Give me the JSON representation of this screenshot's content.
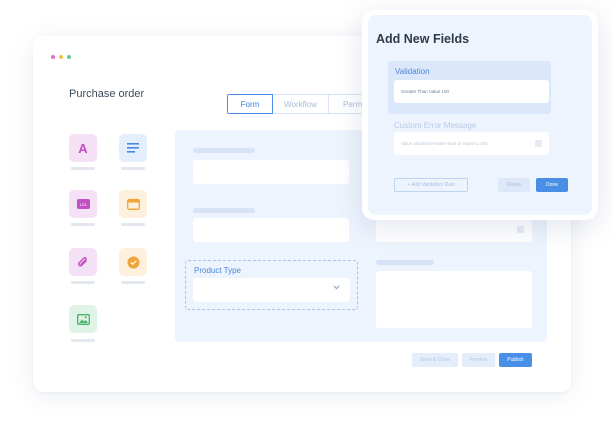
{
  "window": {
    "title": "Purchase order",
    "dots": [
      "#e66ad1",
      "#f2c04d",
      "#5fce8b"
    ]
  },
  "palette": [
    {
      "name": "text",
      "icon": "letter-a-icon",
      "bg": "#f5e1f5",
      "fg": "#c24fc4",
      "glyph": "A"
    },
    {
      "name": "paragraph",
      "icon": "text-lines-icon",
      "bg": "#e5eefc",
      "fg": "#4a87dd",
      "glyph": ""
    },
    {
      "name": "number",
      "icon": "number-icon",
      "bg": "#f5e1f5",
      "fg": "#c24fc4",
      "glyph": "123"
    },
    {
      "name": "date",
      "icon": "calendar-icon",
      "bg": "#fdf0dc",
      "fg": "#f0a53a",
      "glyph": ""
    },
    {
      "name": "attachment",
      "icon": "paperclip-icon",
      "bg": "#f5e1f5",
      "fg": "#c24fc4",
      "glyph": ""
    },
    {
      "name": "checkbox",
      "icon": "check-circle-icon",
      "bg": "#fdf0dc",
      "fg": "#f0a53a",
      "glyph": ""
    },
    {
      "name": "image",
      "icon": "image-icon",
      "bg": "#e0f3e6",
      "fg": "#48b46d",
      "glyph": ""
    }
  ],
  "tabs": [
    {
      "label": "Form",
      "active": true
    },
    {
      "label": "Workflow",
      "active": false
    },
    {
      "label": "Perm",
      "active": false
    }
  ],
  "form": {
    "product_type_label": "Product Type"
  },
  "footer": {
    "save_close": "Save & Close",
    "preview": "Preview",
    "publish": "Publish"
  },
  "popup": {
    "title": "Add New Fields",
    "validation_label": "Validation",
    "validation_value": "Greater Than Value 100",
    "error_label": "Custom Error Message",
    "error_placeholder": "Value should be lesser than or equal to 100",
    "add_rule": "+ Add Validation Rule",
    "delete": "Delete",
    "done": "Done"
  },
  "colors": {
    "accent": "#4a8fe7",
    "canvas": "#eef4fd"
  }
}
